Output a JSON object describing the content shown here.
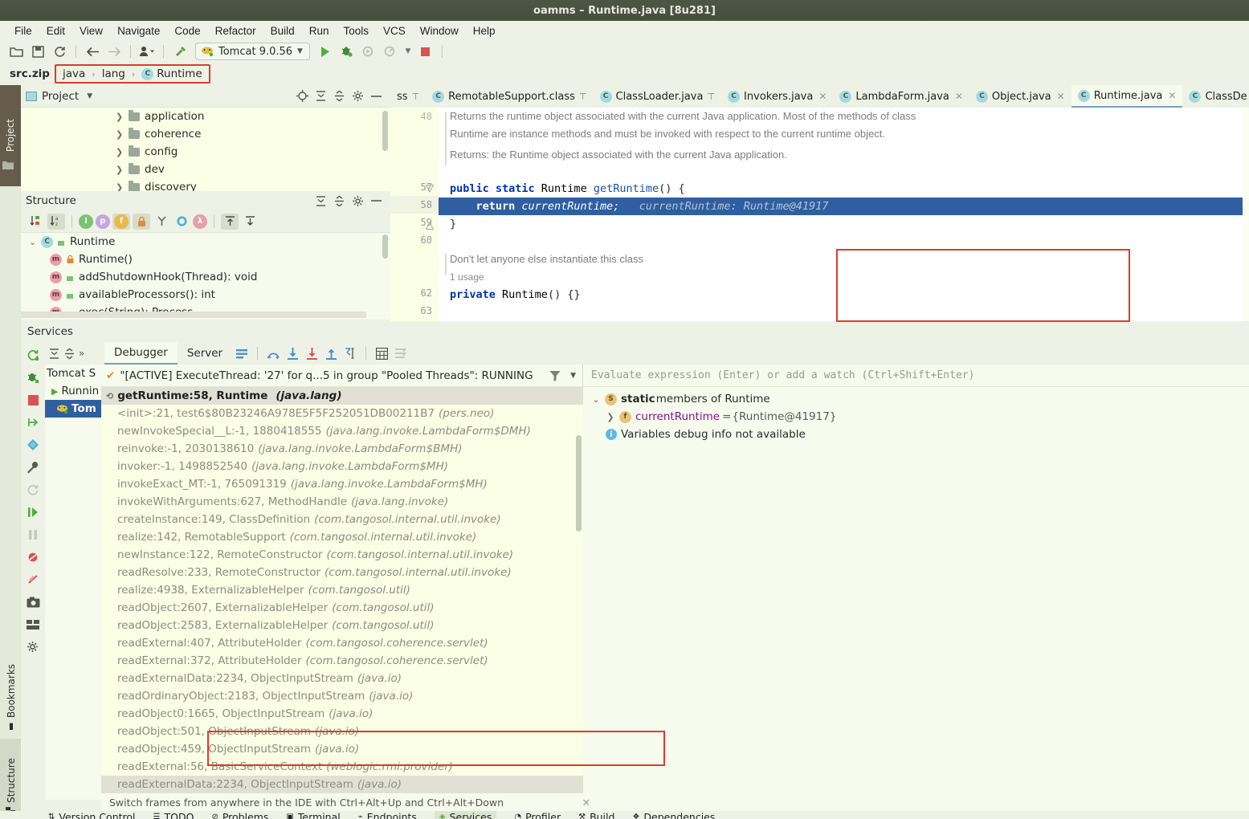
{
  "window": {
    "title": "oamms – Runtime.java [8u281]"
  },
  "menu": {
    "items": [
      "File",
      "Edit",
      "View",
      "Navigate",
      "Code",
      "Refactor",
      "Build",
      "Run",
      "Tools",
      "VCS",
      "Window",
      "Help"
    ]
  },
  "toolbar": {
    "open_label": "open-folder",
    "save_label": "save-all",
    "sync_label": "sync",
    "back_label": "back",
    "forward_label": "forward",
    "profile_label": "profile",
    "build_label": "build",
    "run_config": "Tomcat 9.0.56",
    "run_label": "Run",
    "debug_label": "Debug",
    "run_coverage_label": "Run with Coverage",
    "profiler_label": "Profiler",
    "stop_label": "Stop"
  },
  "breadcrumb": {
    "root": "src.zip",
    "items": [
      "java",
      "lang",
      "Runtime"
    ],
    "sep": "›",
    "class_badge": "C"
  },
  "left_strips": {
    "project": "Project",
    "bookmarks": "Bookmarks",
    "structure": "Structure"
  },
  "project_panel": {
    "title": "Project",
    "items": [
      "application",
      "coherence",
      "config",
      "dev",
      "discovery"
    ]
  },
  "structure_panel": {
    "title": "Structure",
    "tools": [
      "sort-by-visibility",
      "sort-alphabetically",
      "inherited",
      "properties",
      "fields",
      "non-public",
      "show-anonymous",
      "show-interfaces",
      "lambdas",
      "expand-all",
      "collapse-all"
    ],
    "root": "Runtime",
    "members": [
      {
        "name": "Runtime()",
        "access": "private"
      },
      {
        "name": "addShutdownHook(Thread): void",
        "access": "public"
      },
      {
        "name": "availableProcessors(): int",
        "access": "public"
      },
      {
        "name": "exec(String): Process",
        "access": "public"
      }
    ]
  },
  "editor": {
    "tabs": [
      {
        "label": "ss",
        "pinned": true,
        "active": false,
        "truncated": true
      },
      {
        "label": "RemotableSupport.class",
        "pinned": true,
        "active": false
      },
      {
        "label": "ClassLoader.java",
        "pinned": true,
        "active": false
      },
      {
        "label": "Invokers.java",
        "pinned": false,
        "active": false
      },
      {
        "label": "LambdaForm.java",
        "pinned": false,
        "active": false
      },
      {
        "label": "Object.java",
        "pinned": false,
        "active": false
      },
      {
        "label": "Runtime.java",
        "pinned": false,
        "active": true
      },
      {
        "label": "ClassDe",
        "pinned": false,
        "active": false,
        "truncated": true
      }
    ],
    "tab_badge": "C",
    "javadoc": [
      "Returns the runtime object associated with the current Java application. Most of the methods of class",
      "Runtime are instance methods and must be invoked with respect to the current runtime object.",
      "Returns: the Runtime object associated with the current Java application."
    ],
    "comment_line": "Don't let anyone else instantiate this class",
    "usage_hint": "1 usage",
    "lines": [
      {
        "num": "57",
        "text": "public static Runtime getRuntime() {"
      },
      {
        "num": "58",
        "text": "    return currentRuntime;",
        "inlay": "currentRuntime: Runtime@41917",
        "highlighted": true
      },
      {
        "num": "59",
        "text": "}"
      },
      {
        "num": "60",
        "text": ""
      },
      {
        "num": "62",
        "text": "private Runtime() {}"
      },
      {
        "num": "63",
        "text": ""
      }
    ]
  },
  "services": {
    "title": "Services",
    "tree_label": "Tomcat S",
    "tree_running": "Runnin",
    "tree_selected": "Tom",
    "tabs": [
      {
        "label": "Debugger",
        "active": true
      },
      {
        "label": "Server",
        "active": false
      }
    ],
    "toolbar_icons": [
      "mute-breakpoints",
      "step-over",
      "step-into",
      "force-step-into",
      "step-out",
      "run-to-cursor",
      "evaluate-expression",
      "settings"
    ],
    "thread": "\"[ACTIVE] ExecuteThread: '27' for q...5 in group \"Pooled Threads\": RUNNING",
    "frames": [
      {
        "text": "getRuntime:58, Runtime",
        "pkg": "(java.lang)",
        "top": true
      },
      {
        "text": "<init>:21, test6$80B23246A978E5F5F252051DB00211B7",
        "pkg": "(pers.neo)"
      },
      {
        "text": "newInvokeSpecial__L:-1, 1880418555",
        "pkg": "(java.lang.invoke.LambdaForm$DMH)"
      },
      {
        "text": "reinvoke:-1, 2030138610",
        "pkg": "(java.lang.invoke.LambdaForm$BMH)"
      },
      {
        "text": "invoker:-1, 1498852540",
        "pkg": "(java.lang.invoke.LambdaForm$MH)"
      },
      {
        "text": "invokeExact_MT:-1, 765091319",
        "pkg": "(java.lang.invoke.LambdaForm$MH)"
      },
      {
        "text": "invokeWithArguments:627, MethodHandle",
        "pkg": "(java.lang.invoke)"
      },
      {
        "text": "createInstance:149, ClassDefinition",
        "pkg": "(com.tangosol.internal.util.invoke)"
      },
      {
        "text": "realize:142, RemotableSupport",
        "pkg": "(com.tangosol.internal.util.invoke)"
      },
      {
        "text": "newInstance:122, RemoteConstructor",
        "pkg": "(com.tangosol.internal.util.invoke)"
      },
      {
        "text": "readResolve:233, RemoteConstructor",
        "pkg": "(com.tangosol.internal.util.invoke)"
      },
      {
        "text": "realize:4938, ExternalizableHelper",
        "pkg": "(com.tangosol.util)"
      },
      {
        "text": "readObject:2607, ExternalizableHelper",
        "pkg": "(com.tangosol.util)"
      },
      {
        "text": "readObject:2583, ExternalizableHelper",
        "pkg": "(com.tangosol.util)"
      },
      {
        "text": "readExternal:407, AttributeHolder",
        "pkg": "(com.tangosol.coherence.servlet)"
      },
      {
        "text": "readExternal:372, AttributeHolder",
        "pkg": "(com.tangosol.coherence.servlet)"
      },
      {
        "text": "readExternalData:2234, ObjectInputStream",
        "pkg": "(java.io)"
      },
      {
        "text": "readOrdinaryObject:2183, ObjectInputStream",
        "pkg": "(java.io)"
      },
      {
        "text": "readObject0:1665, ObjectInputStream",
        "pkg": "(java.io)"
      },
      {
        "text": "readObject:501, ObjectInputStream",
        "pkg": "(java.io)"
      },
      {
        "text": "readObject:459, ObjectInputStream",
        "pkg": "(java.io)"
      },
      {
        "text": "readExternal:56, BasicServiceContext",
        "pkg": "(weblogic.rmi.provider)"
      },
      {
        "text": "readExternalData:2234, ObjectInputStream",
        "pkg": "(java.io)",
        "selected": true
      }
    ],
    "evaluate_placeholder": "Evaluate expression (Enter) or add a watch (Ctrl+Shift+Enter)",
    "variables": [
      {
        "kind": "static",
        "label_bold": "static",
        "label": " members of Runtime",
        "badge": "S",
        "expanded": true
      },
      {
        "kind": "field",
        "name": "currentRuntime",
        "eq": " = ",
        "value": "{Runtime@41917}",
        "badge": "f"
      },
      {
        "kind": "info",
        "text": "Variables debug info not available"
      }
    ],
    "hint": "Switch frames from anywhere in the IDE with Ctrl+Alt+Up and Ctrl+Alt+Down"
  },
  "statusbar": {
    "items": [
      "Version Control",
      "TODO",
      "Problems",
      "Terminal",
      "Endpoints",
      "Services",
      "Profiler",
      "Build",
      "Dependencies"
    ],
    "active": "Services"
  },
  "colors": {
    "accent_red": "#e03b28",
    "selection_blue": "#2f5fa0",
    "keyword_blue": "#0033b3",
    "panel_bg": "#eef2e6",
    "editor_bg": "#ffffff",
    "tree_bg": "#fbffe6"
  }
}
